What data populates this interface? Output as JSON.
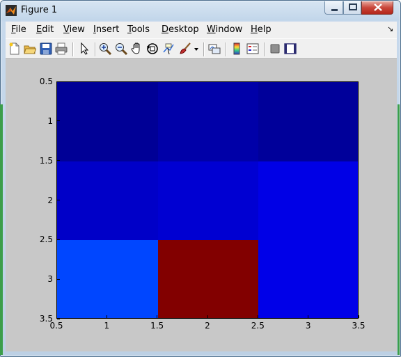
{
  "window": {
    "title": "Figure 1",
    "frame_color": "#c2d6ea",
    "close_color": "#c9463a"
  },
  "menu": {
    "items": [
      {
        "label": "File",
        "mnemonic": "F",
        "rest": "ile"
      },
      {
        "label": "Edit",
        "mnemonic": "E",
        "rest": "dit"
      },
      {
        "label": "View",
        "mnemonic": "V",
        "rest": "iew"
      },
      {
        "label": "Insert",
        "mnemonic": "I",
        "rest": "nsert"
      },
      {
        "label": "Tools",
        "mnemonic": "T",
        "rest": "ools"
      },
      {
        "label": "Desktop",
        "mnemonic": "D",
        "rest": "esktop"
      },
      {
        "label": "Window",
        "mnemonic": "W",
        "rest": "indow"
      },
      {
        "label": "Help",
        "mnemonic": "H",
        "rest": "elp"
      }
    ],
    "overflow_icon": "dock-arrow-icon"
  },
  "toolbar": {
    "icons": [
      "new-figure-icon",
      "open-file-icon",
      "save-figure-icon",
      "print-figure-icon",
      "edit-plot-arrow-icon",
      "zoom-in-icon",
      "zoom-out-icon",
      "pan-hand-icon",
      "rotate-3d-icon",
      "data-cursor-icon",
      "brush-icon",
      "brush-dropdown-icon",
      "link-plot-icon",
      "insert-colorbar-icon",
      "insert-legend-icon",
      "hide-plot-tools-icon",
      "show-plot-tools-icon"
    ]
  },
  "chart_data": {
    "type": "heatmap",
    "x_tick_labels": [
      "0.5",
      "1",
      "1.5",
      "2",
      "2.5",
      "3",
      "3.5"
    ],
    "y_tick_labels": [
      "0.5",
      "1",
      "1.5",
      "2",
      "2.5",
      "3",
      "3.5"
    ],
    "x_ticks": [
      0.5,
      1,
      1.5,
      2,
      2.5,
      3,
      3.5
    ],
    "y_ticks": [
      0.5,
      1,
      1.5,
      2,
      2.5,
      3,
      3.5
    ],
    "xlim": [
      0.5,
      3.5
    ],
    "ylim": [
      0.5,
      3.5
    ],
    "y_direction": "reverse",
    "colormap": "jet",
    "cell_colors": [
      [
        "#000096",
        "#0000a8",
        "#00009a"
      ],
      [
        "#0000c8",
        "#0000d2",
        "#0000e6"
      ],
      [
        "#0046ff",
        "#820000",
        "#0000e8"
      ]
    ],
    "figure_background": "#c8c8c8"
  }
}
